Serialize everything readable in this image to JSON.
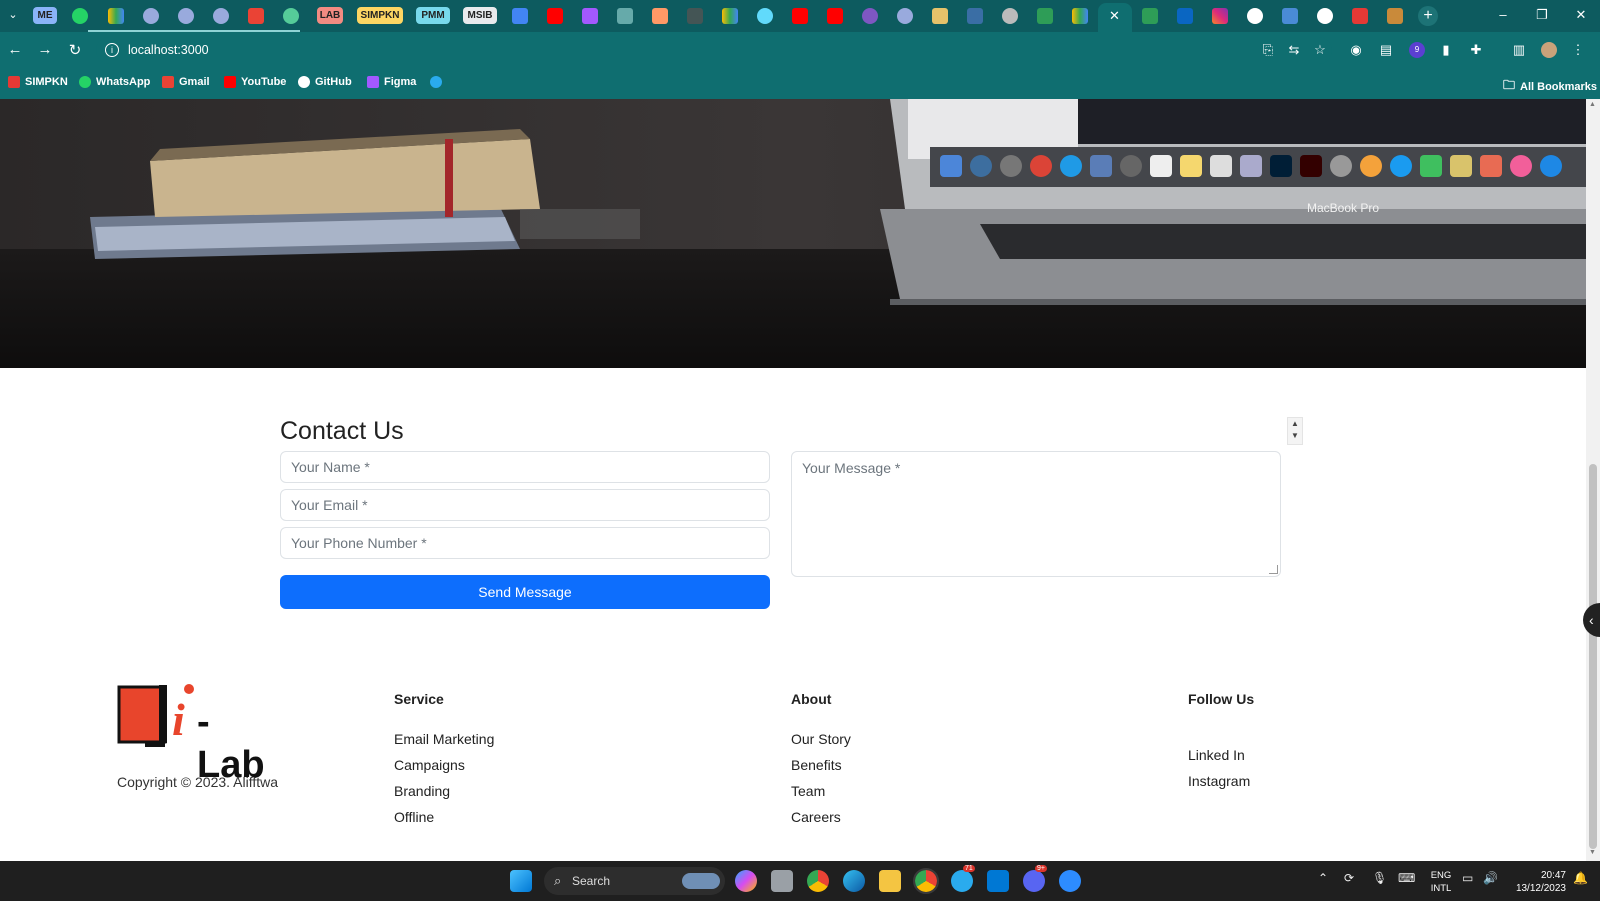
{
  "browser": {
    "tab_pills": [
      "ME",
      "LAB",
      "SIMPKN",
      "PMM",
      "MSIB"
    ],
    "url": "localhost:3000",
    "bookmarks": [
      "SIMPKN",
      "WhatsApp",
      "Gmail",
      "YouTube",
      "GitHub",
      "Figma"
    ],
    "all_bookmarks_label": "All Bookmarks",
    "extension_badge": "9"
  },
  "hero": {
    "laptop_label": "MacBook Pro"
  },
  "contact": {
    "title": "Contact Us",
    "name_placeholder": "Your Name *",
    "email_placeholder": "Your Email *",
    "phone_placeholder": "Your Phone Number *",
    "message_placeholder": "Your Message *",
    "send_label": "Send Message"
  },
  "footer": {
    "logo_text": "-Lab",
    "logo_letter": "i",
    "copyright": "Copyright © 2023. Alifftwa",
    "service": {
      "heading": "Service",
      "items": [
        "Email Marketing",
        "Campaigns",
        "Branding",
        "Offline"
      ]
    },
    "about": {
      "heading": "About",
      "items": [
        "Our Story",
        "Benefits",
        "Team",
        "Careers"
      ]
    },
    "follow": {
      "heading": "Follow Us",
      "items": [
        "Linked In",
        "Instagram"
      ]
    }
  },
  "taskbar": {
    "search_label": "Search",
    "lang_line1": "ENG",
    "lang_line2": "INTL",
    "time": "20:47",
    "date": "13/12/2023",
    "telegram_badge": "71",
    "discord_badge": "9+"
  },
  "colors": {
    "chrome_dark": "#0d5b5f",
    "chrome": "#0f6e70",
    "primary_button": "#0d6efd",
    "logo_red": "#e8452c"
  }
}
